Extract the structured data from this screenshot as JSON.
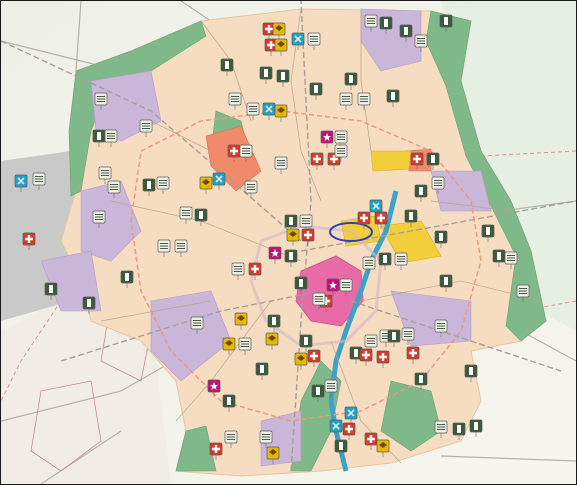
{
  "map": {
    "zone_colors": {
      "residential": "#f6dcc0",
      "mixed": "#c9b6d8",
      "green": "#7fb98a",
      "center": "#e86aa6",
      "industrial": "#f2cf3a",
      "public": "#f08a6a",
      "water": "#3ba3c7",
      "outer": "#c8c8c8",
      "highlight_ring": "#2b3fbf"
    },
    "icon_colors": {
      "housing": "#3a5a3a",
      "health": "#d83a2a",
      "education": "#e6b800",
      "sport": "#1fa3c4",
      "landmark": "#c2127a"
    },
    "icon_kinds": [
      "housing-icon",
      "health-icon",
      "education-icon",
      "sport-icon",
      "landmark-icon",
      "grid-icon"
    ],
    "legend": [],
    "labels": []
  }
}
